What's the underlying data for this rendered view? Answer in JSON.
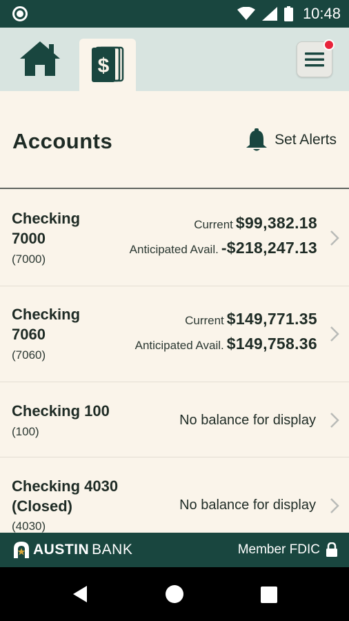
{
  "status_bar": {
    "time": "10:48"
  },
  "nav": {
    "home_icon": "home-icon",
    "accounts_icon": "dollar-cards-icon",
    "menu_icon": "hamburger-menu-icon"
  },
  "header": {
    "title": "Accounts",
    "set_alerts_label": "Set Alerts"
  },
  "accounts": [
    {
      "name_line1": "Checking",
      "name_line2": "7000",
      "number": "(7000)",
      "current_label": "Current",
      "current_value": "$99,382.18",
      "anticipated_label": "Anticipated Avail.",
      "anticipated_value": "-$218,247.13"
    },
    {
      "name_line1": "Checking",
      "name_line2": "7060",
      "number": "(7060)",
      "current_label": "Current",
      "current_value": "$149,771.35",
      "anticipated_label": "Anticipated Avail.",
      "anticipated_value": "$149,758.36"
    },
    {
      "name_line1": "Checking 100",
      "number": "(100)",
      "no_balance": "No balance for display"
    },
    {
      "name_line1": "Checking 4030",
      "name_line2": "(Closed)",
      "number": "(4030)",
      "no_balance": "No balance for display"
    }
  ],
  "footer": {
    "brand_bold": "AUSTIN",
    "brand_light": "BANK",
    "fdic_label": "Member FDIC"
  },
  "colors": {
    "primary": "#19463f",
    "background": "#faf4ea",
    "nav_background": "#d8e4e0",
    "notification": "#e8233a"
  }
}
